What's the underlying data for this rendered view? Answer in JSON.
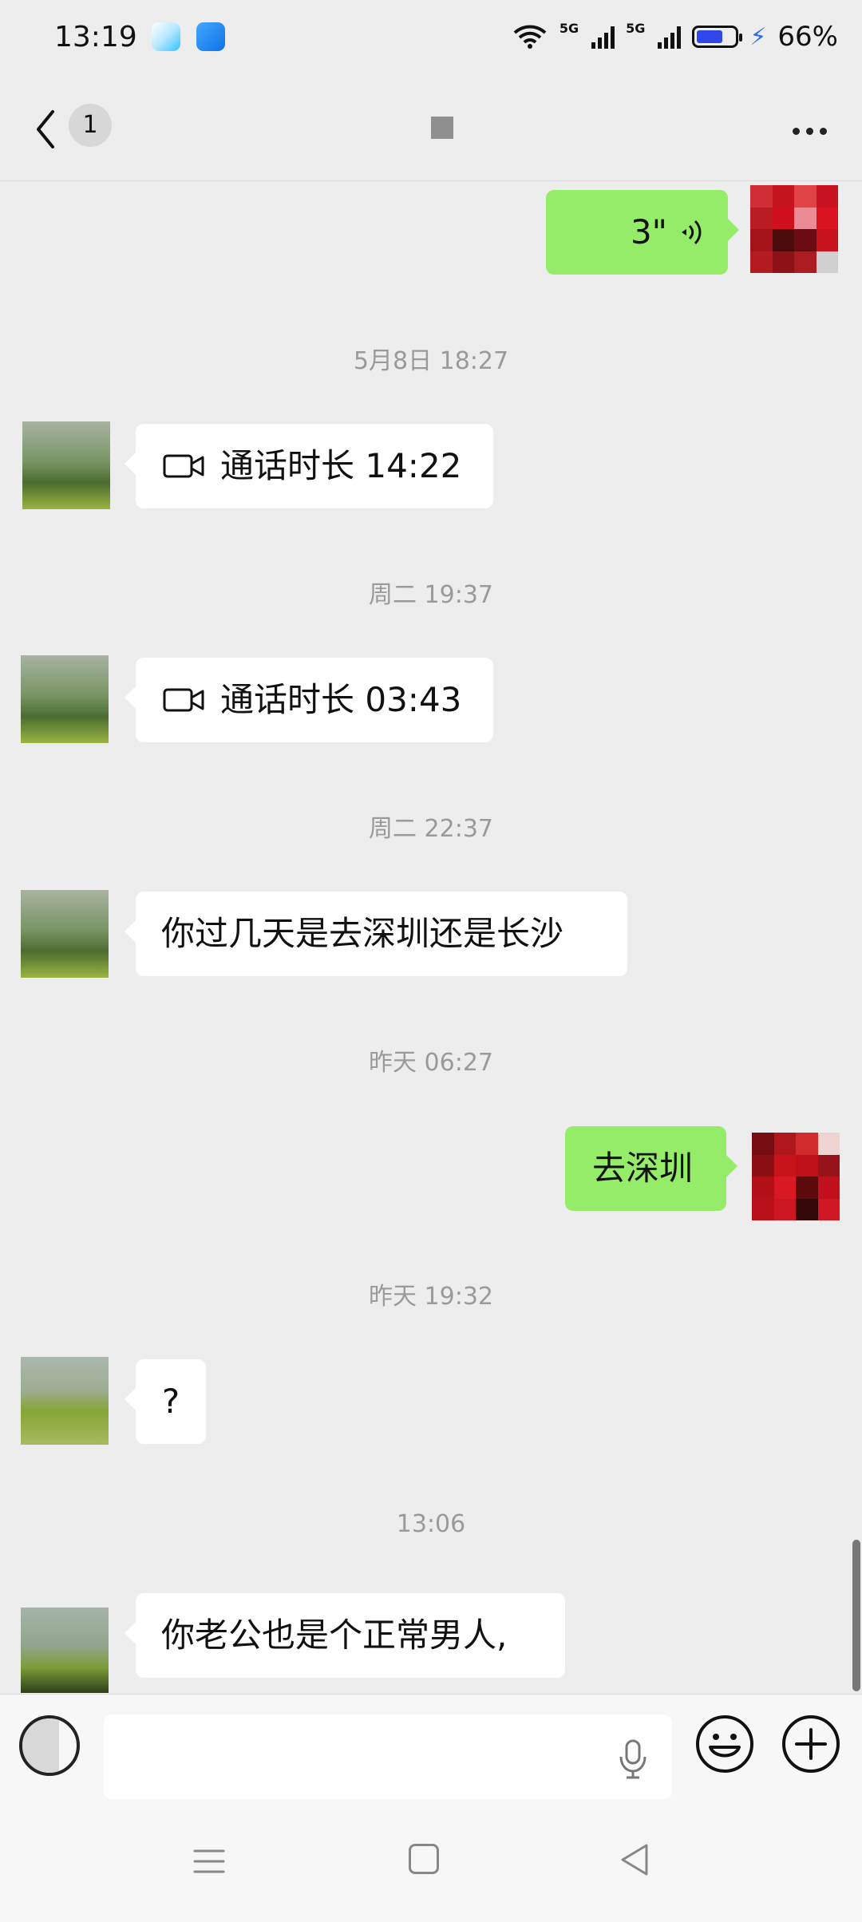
{
  "status": {
    "time": "13:19",
    "network1": "5G",
    "network2": "5G",
    "battery": "66%"
  },
  "header": {
    "unread_count": "1",
    "title": ""
  },
  "messages": [
    {
      "type": "voice",
      "side": "out",
      "duration": "3\""
    },
    {
      "type": "time",
      "text": "5月8日 18:27"
    },
    {
      "type": "call",
      "side": "in",
      "label": "通话时长 14:22"
    },
    {
      "type": "time",
      "text": "周二 19:37"
    },
    {
      "type": "call",
      "side": "in",
      "label": "通话时长 03:43"
    },
    {
      "type": "time",
      "text": "周二 22:37"
    },
    {
      "type": "text",
      "side": "in",
      "text": "你过几天是去深圳还是长沙"
    },
    {
      "type": "time",
      "text": "昨天 06:27"
    },
    {
      "type": "text",
      "side": "out",
      "text": "去深圳"
    },
    {
      "type": "time",
      "text": "昨天 19:32"
    },
    {
      "type": "text",
      "side": "in",
      "text": "?"
    },
    {
      "type": "time",
      "text": "13:06"
    },
    {
      "type": "text",
      "side": "in",
      "text": "你老公也是个正常男人,"
    }
  ],
  "input": {
    "value": ""
  },
  "icons": {
    "wifi": "wifi-icon",
    "video": "video-call-icon",
    "voice": "voice-wave-icon",
    "mic": "microphone-icon",
    "emoji": "emoji-icon",
    "plus": "plus-icon",
    "back": "back-arrow-icon",
    "more": "more-icon"
  },
  "colors": {
    "outgoing": "#95ec69",
    "incoming": "#ffffff",
    "background": "#ededed",
    "battery_accent": "#2f47e8"
  }
}
